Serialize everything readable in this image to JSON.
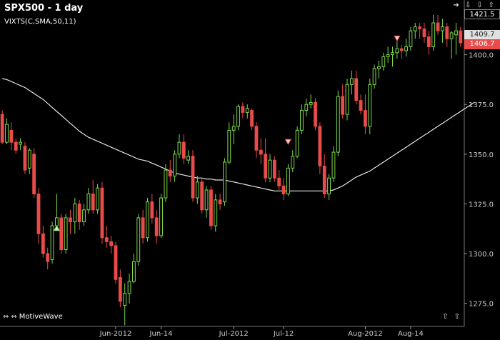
{
  "header": {
    "title": "SPX500 - 1 day",
    "indicator": "VIXTS(C,SMA,50,11)"
  },
  "footer": {
    "brand": "MotiveWave"
  },
  "price_tags": {
    "high": "1421.5",
    "mid": "1409.7",
    "last": "1406.7"
  },
  "colors": {
    "up": "#7ddc4a",
    "down": "#e94a4a",
    "ma": "#e6e6e6",
    "background": "#000000"
  },
  "icons": {
    "nav_left": "double-arrow-left-icon",
    "nav_right": "double-arrow-right-icon",
    "scroll_down": "arrow-down-icon",
    "scroll_up": "arrow-up-icon"
  },
  "chart_data": {
    "type": "candlestick",
    "title": "SPX500 - 1 day",
    "ylim": [
      1263,
      1428
    ],
    "y_ticks": [
      1275.0,
      1300.0,
      1325.0,
      1350.0,
      1375.0,
      1400.0
    ],
    "x_tick_labels": [
      {
        "label": "Jun-2012",
        "bar": 25
      },
      {
        "label": "Jun-14",
        "bar": 35
      },
      {
        "label": "Jul-2012",
        "bar": 51
      },
      {
        "label": "Jul-12",
        "bar": 62
      },
      {
        "label": "Aug-2012",
        "bar": 80
      },
      {
        "label": "Aug-14",
        "bar": 90
      }
    ],
    "ma": {
      "name": "SMA 50",
      "values": [
        1388.0,
        1387.5,
        1386.5,
        1385.5,
        1384.5,
        1383.5,
        1382.0,
        1380.5,
        1379.0,
        1377.5,
        1375.5,
        1373.5,
        1371.5,
        1369.5,
        1367.5,
        1365.5,
        1363.5,
        1361.5,
        1360.0,
        1358.5,
        1357.5,
        1356.5,
        1355.5,
        1354.5,
        1353.5,
        1352.5,
        1351.5,
        1350.5,
        1349.5,
        1348.5,
        1347.5,
        1347.0,
        1346.5,
        1345.5,
        1344.5,
        1343.5,
        1342.5,
        1341.5,
        1340.5,
        1340.0,
        1339.5,
        1339.0,
        1338.5,
        1338.0,
        1338.0,
        1337.5,
        1337.5,
        1337.0,
        1337.0,
        1337.0,
        1336.5,
        1336.0,
        1335.5,
        1335.0,
        1334.5,
        1334.0,
        1333.5,
        1333.0,
        1332.5,
        1332.0,
        1331.5,
        1331.5,
        1331.5,
        1331.5,
        1331.5,
        1331.5,
        1331.5,
        1331.5,
        1331.5,
        1331.5,
        1331.5,
        1331.5,
        1331.5,
        1332.0,
        1333.0,
        1334.0,
        1335.5,
        1337.0,
        1338.5,
        1339.5,
        1340.5,
        1341.5,
        1343.0,
        1344.5,
        1346.0,
        1347.5,
        1349.0,
        1350.5,
        1352.0,
        1353.5,
        1355.0,
        1356.5,
        1358.0,
        1359.5,
        1361.0,
        1362.5,
        1364.0,
        1365.5,
        1367.0,
        1368.5,
        1370.0,
        1371.5,
        1373.0,
        1374.5,
        1376.0
      ]
    },
    "candles": [
      [
        1370,
        1372,
        1355,
        1356
      ],
      [
        1356,
        1368,
        1355,
        1365
      ],
      [
        1362,
        1366,
        1352,
        1356
      ],
      [
        1356,
        1358,
        1350,
        1352
      ],
      [
        1355,
        1358,
        1352,
        1356
      ],
      [
        1354,
        1356,
        1340,
        1342
      ],
      [
        1343,
        1353,
        1340,
        1352
      ],
      [
        1350,
        1353,
        1328,
        1330
      ],
      [
        1330,
        1333,
        1305,
        1310
      ],
      [
        1310,
        1314,
        1298,
        1300
      ],
      [
        1300,
        1303,
        1292,
        1296
      ],
      [
        1297,
        1316,
        1295,
        1314
      ],
      [
        1314,
        1330,
        1312,
        1318
      ],
      [
        1318,
        1320,
        1300,
        1302
      ],
      [
        1302,
        1320,
        1300,
        1318
      ],
      [
        1318,
        1322,
        1310,
        1316
      ],
      [
        1316,
        1328,
        1310,
        1325
      ],
      [
        1325,
        1327,
        1312,
        1316
      ],
      [
        1316,
        1325,
        1314,
        1322
      ],
      [
        1322,
        1333,
        1320,
        1330
      ],
      [
        1330,
        1337,
        1320,
        1322
      ],
      [
        1322,
        1335,
        1320,
        1333
      ],
      [
        1333,
        1336,
        1305,
        1308
      ],
      [
        1308,
        1314,
        1303,
        1306
      ],
      [
        1306,
        1309,
        1300,
        1304
      ],
      [
        1304,
        1306,
        1285,
        1287
      ],
      [
        1288,
        1292,
        1273,
        1276
      ],
      [
        1274,
        1285,
        1264,
        1280
      ],
      [
        1280,
        1290,
        1275,
        1286
      ],
      [
        1286,
        1300,
        1285,
        1296
      ],
      [
        1296,
        1320,
        1294,
        1318
      ],
      [
        1318,
        1322,
        1305,
        1308
      ],
      [
        1308,
        1328,
        1306,
        1326
      ],
      [
        1326,
        1330,
        1315,
        1318
      ],
      [
        1318,
        1322,
        1305,
        1309
      ],
      [
        1309,
        1330,
        1308,
        1328
      ],
      [
        1328,
        1345,
        1326,
        1342
      ],
      [
        1342,
        1347,
        1336,
        1339
      ],
      [
        1339,
        1352,
        1336,
        1350
      ],
      [
        1350,
        1360,
        1348,
        1356
      ],
      [
        1356,
        1360,
        1345,
        1348
      ],
      [
        1347,
        1352,
        1345,
        1349
      ],
      [
        1349,
        1352,
        1326,
        1328
      ],
      [
        1328,
        1339,
        1325,
        1336
      ],
      [
        1336,
        1338,
        1320,
        1322
      ],
      [
        1322,
        1334,
        1318,
        1332
      ],
      [
        1332,
        1334,
        1312,
        1314
      ],
      [
        1314,
        1330,
        1311,
        1327
      ],
      [
        1327,
        1330,
        1322,
        1325
      ],
      [
        1326,
        1348,
        1324,
        1346
      ],
      [
        1346,
        1366,
        1345,
        1362
      ],
      [
        1362,
        1370,
        1355,
        1364
      ],
      [
        1364,
        1375,
        1362,
        1374
      ],
      [
        1374,
        1376,
        1368,
        1371
      ],
      [
        1371,
        1375,
        1368,
        1373
      ],
      [
        1372,
        1373,
        1362,
        1364
      ],
      [
        1364,
        1366,
        1348,
        1352
      ],
      [
        1352,
        1358,
        1345,
        1350
      ],
      [
        1350,
        1358,
        1336,
        1338
      ],
      [
        1338,
        1350,
        1336,
        1347
      ],
      [
        1347,
        1349,
        1336,
        1338
      ],
      [
        1338,
        1342,
        1332,
        1334
      ],
      [
        1334,
        1338,
        1327,
        1330
      ],
      [
        1330,
        1345,
        1329,
        1343
      ],
      [
        1343,
        1352,
        1341,
        1349
      ],
      [
        1349,
        1364,
        1348,
        1362
      ],
      [
        1362,
        1375,
        1360,
        1372
      ],
      [
        1372,
        1378,
        1369,
        1375
      ],
      [
        1375,
        1380,
        1373,
        1376
      ],
      [
        1376,
        1378,
        1362,
        1364
      ],
      [
        1364,
        1366,
        1340,
        1344
      ],
      [
        1344,
        1350,
        1328,
        1330
      ],
      [
        1330,
        1340,
        1327,
        1338
      ],
      [
        1338,
        1354,
        1336,
        1351
      ],
      [
        1351,
        1382,
        1349,
        1379
      ],
      [
        1379,
        1385,
        1368,
        1370
      ],
      [
        1370,
        1388,
        1367,
        1385
      ],
      [
        1385,
        1392,
        1380,
        1388
      ],
      [
        1388,
        1392,
        1375,
        1377
      ],
      [
        1377,
        1380,
        1370,
        1372
      ],
      [
        1372,
        1380,
        1360,
        1364
      ],
      [
        1364,
        1388,
        1360,
        1385
      ],
      [
        1385,
        1395,
        1383,
        1393
      ],
      [
        1393,
        1397,
        1388,
        1394
      ],
      [
        1394,
        1401,
        1392,
        1399
      ],
      [
        1399,
        1404,
        1396,
        1400
      ],
      [
        1400,
        1404,
        1394,
        1401
      ],
      [
        1401,
        1408,
        1398,
        1403
      ],
      [
        1403,
        1405,
        1398,
        1402
      ],
      [
        1402,
        1408,
        1399,
        1404
      ],
      [
        1404,
        1414,
        1402,
        1412
      ],
      [
        1412,
        1416,
        1408,
        1414
      ],
      [
        1414,
        1416,
        1408,
        1413
      ],
      [
        1413,
        1416,
        1406,
        1409
      ],
      [
        1409,
        1412,
        1400,
        1404
      ],
      [
        1404,
        1420,
        1402,
        1416
      ],
      [
        1416,
        1420,
        1410,
        1412
      ],
      [
        1412,
        1418,
        1406,
        1414
      ],
      [
        1414,
        1416,
        1404,
        1408
      ],
      [
        1408,
        1412,
        1398,
        1411
      ],
      [
        1410,
        1416,
        1400,
        1412
      ],
      [
        1412,
        1414,
        1404,
        1406
      ]
    ],
    "markers": [
      {
        "bar": 12,
        "type": "up",
        "value": 1313
      },
      {
        "bar": 63,
        "type": "down",
        "value": 1356
      },
      {
        "bar": 87,
        "type": "down",
        "value": 1408
      }
    ]
  }
}
